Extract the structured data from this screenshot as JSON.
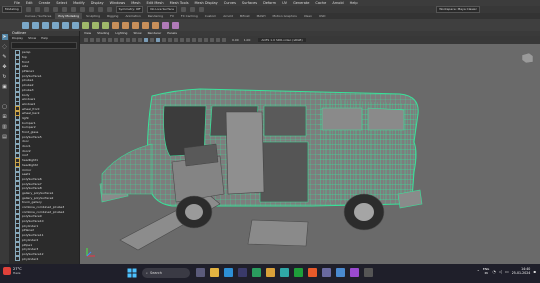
{
  "menubar": {
    "items": [
      "File",
      "Edit",
      "Create",
      "Select",
      "Modify",
      "Display",
      "Windows",
      "Mesh",
      "Edit Mesh",
      "Mesh Tools",
      "Mesh Display",
      "Curves",
      "Surfaces",
      "Deform",
      "UV",
      "Generate",
      "Cache",
      "Arnold",
      "Help"
    ],
    "workspace": "Workspace: Maya Classic"
  },
  "statusline": {
    "mode": "Modeling",
    "symmetry": "Symmetry: Off",
    "live": "No Live Surface",
    "workspace_label": "Workspace: Maya Classic"
  },
  "shelf": {
    "tabs": [
      "Curves / Surfaces",
      "Poly Modeling",
      "Sculpting",
      "Rigging",
      "Animation",
      "Rendering",
      "FX",
      "FX Caching",
      "Custom",
      "Arnold",
      "Bifrost",
      "MASH",
      "Motion Graphics",
      "XGen",
      "USD"
    ],
    "active_tab": 1
  },
  "outliner": {
    "title": "Outliner",
    "menu": [
      "Display",
      "Show",
      "Help"
    ],
    "rows": [
      {
        "label": "persp",
        "type": "cam"
      },
      {
        "label": "top",
        "type": "cam"
      },
      {
        "label": "front",
        "type": "cam"
      },
      {
        "label": "side",
        "type": "cam"
      },
      {
        "label": "pPlane1",
        "type": "mesh"
      },
      {
        "label": "polySurface1",
        "type": "mesh"
      },
      {
        "label": "pCube1",
        "type": "mesh"
      },
      {
        "label": "pCube2",
        "type": "mesh"
      },
      {
        "label": "pCube3",
        "type": "mesh"
      },
      {
        "label": "body",
        "type": "mesh"
      },
      {
        "label": "window1",
        "type": "mesh"
      },
      {
        "label": "window2",
        "type": "mesh"
      },
      {
        "label": "wheel_front",
        "type": "grp"
      },
      {
        "label": "wheel_back",
        "type": "grp"
      },
      {
        "label": "light",
        "type": "mesh"
      },
      {
        "label": "bumper1",
        "type": "mesh"
      },
      {
        "label": "bumper2",
        "type": "mesh"
      },
      {
        "label": "front_glass",
        "type": "mesh"
      },
      {
        "label": "polySurface5",
        "type": "mesh"
      },
      {
        "label": "door",
        "type": "mesh"
      },
      {
        "label": "door1",
        "type": "mesh"
      },
      {
        "label": "door2",
        "type": "mesh"
      },
      {
        "label": "roof",
        "type": "mesh"
      },
      {
        "label": "headlight1",
        "type": "grp"
      },
      {
        "label": "headlight2",
        "type": "grp"
      },
      {
        "label": "mirror",
        "type": "mesh"
      },
      {
        "label": "seat1",
        "type": "mesh"
      },
      {
        "label": "polySurface6",
        "type": "mesh"
      },
      {
        "label": "polySurface7",
        "type": "mesh"
      },
      {
        "label": "polySurface8",
        "type": "mesh"
      },
      {
        "label": "gallery_polySurface1",
        "type": "mesh"
      },
      {
        "label": "gallery_polySurface2",
        "type": "mesh"
      },
      {
        "label": "trunk_gallery",
        "type": "mesh"
      },
      {
        "label": "combine_combined_pCube3",
        "type": "mesh"
      },
      {
        "label": "combine_combined_pCube4",
        "type": "mesh"
      },
      {
        "label": "polySurface9",
        "type": "mesh"
      },
      {
        "label": "polySurface10",
        "type": "mesh"
      },
      {
        "label": "pCylinder1",
        "type": "mesh"
      },
      {
        "label": "pPlane2",
        "type": "mesh"
      },
      {
        "label": "polySurface11",
        "type": "mesh"
      },
      {
        "label": "pCylinder2",
        "type": "mesh"
      },
      {
        "label": "pPipe1",
        "type": "mesh"
      },
      {
        "label": "pCylinder3",
        "type": "mesh"
      },
      {
        "label": "polySurface12",
        "type": "mesh"
      },
      {
        "label": "pCylinder4",
        "type": "mesh"
      }
    ]
  },
  "panel": {
    "menu": [
      "View",
      "Shading",
      "Lighting",
      "Show",
      "Renderer",
      "Panels"
    ],
    "exposure": "0.00",
    "gamma": "1.00",
    "colorspace": "ACES 1.0 SDR-video (sRGB)"
  },
  "taskbar": {
    "weather_temp": "27°C",
    "weather_desc": "Haze",
    "search_placeholder": "Search",
    "lang": "ENG",
    "region": "IN",
    "time": "14:40",
    "date": "25-01-2024"
  },
  "colors": {
    "wireframe": "#38e39a",
    "viewport": "#6a6a6a",
    "accent": "#5285a6"
  }
}
